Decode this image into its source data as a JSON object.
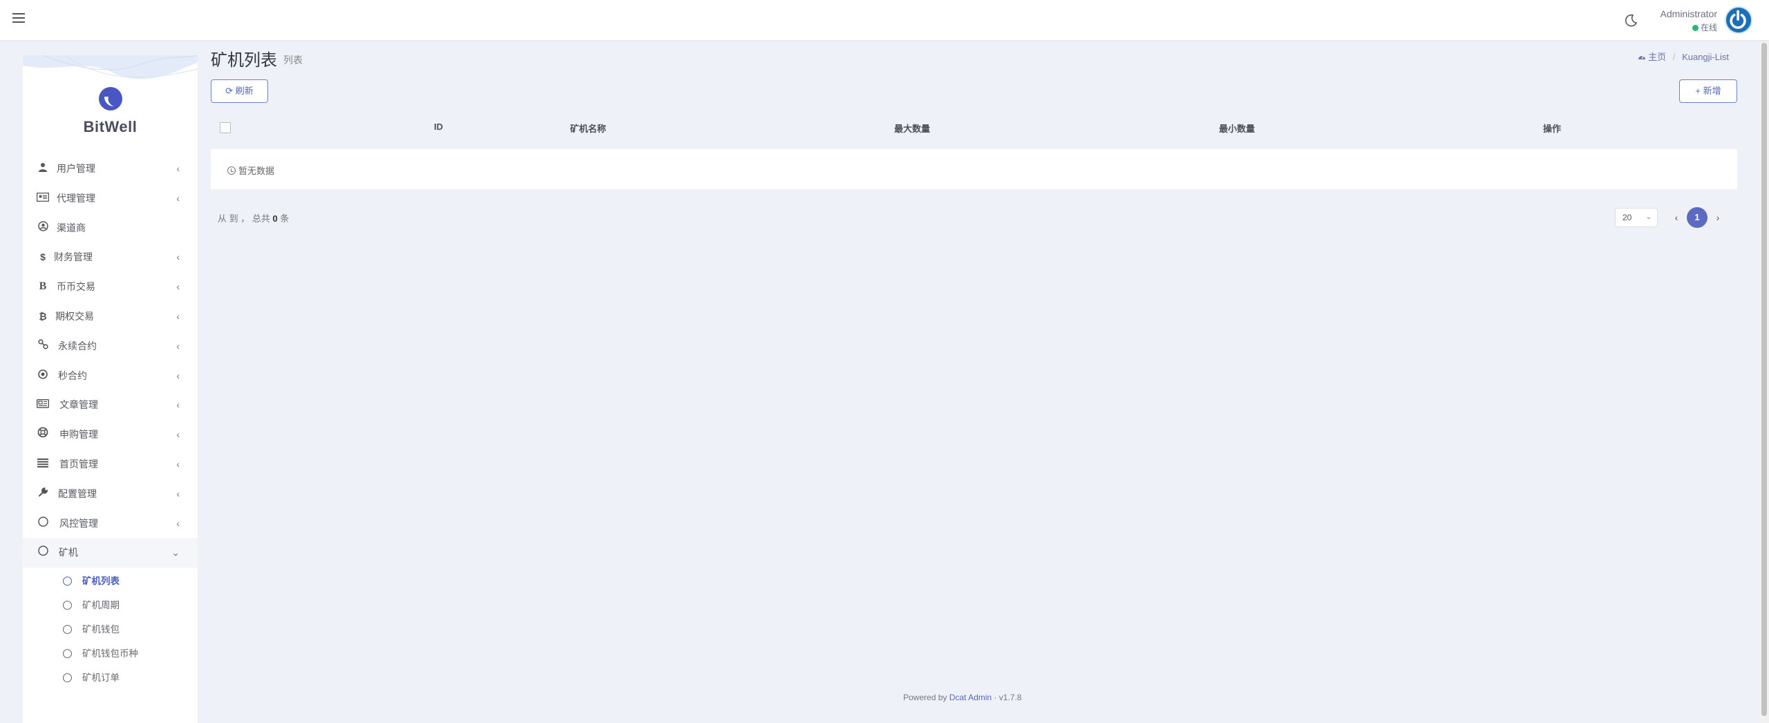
{
  "header": {
    "user_name": "Administrator",
    "user_status": "在线",
    "colors": {
      "status_online": "#21b978",
      "avatar": "#1a6fb8"
    }
  },
  "sidebar": {
    "brand": "BitWell",
    "items": [
      {
        "label": "用户管理",
        "icon": "user-tie-icon"
      },
      {
        "label": "代理管理",
        "icon": "id-card-icon"
      },
      {
        "label": "渠道商",
        "icon": "user-circle-icon"
      },
      {
        "label": "财务管理",
        "icon": "dollar-icon"
      },
      {
        "label": "币币交易",
        "icon": "bold-b-icon"
      },
      {
        "label": "期权交易",
        "icon": "bitcoin-icon"
      },
      {
        "label": "永续合约",
        "icon": "link-icon"
      },
      {
        "label": "秒合约",
        "icon": "dot-circle-icon"
      },
      {
        "label": "文章管理",
        "icon": "newspaper-icon"
      },
      {
        "label": "申购管理",
        "icon": "life-ring-icon"
      },
      {
        "label": "首页管理",
        "icon": "list-icon"
      },
      {
        "label": "配置管理",
        "icon": "wrench-icon"
      },
      {
        "label": "风控管理",
        "icon": "circle-icon"
      },
      {
        "label": "矿机",
        "icon": "circle-icon"
      }
    ],
    "submenu": [
      {
        "label": "矿机列表",
        "active": true
      },
      {
        "label": "矿机周期"
      },
      {
        "label": "矿机钱包"
      },
      {
        "label": "矿机钱包币种"
      },
      {
        "label": "矿机订单"
      }
    ],
    "colors": {
      "active": "#4b5ec2"
    }
  },
  "content": {
    "title": "矿机列表",
    "subtitle": "列表",
    "breadcrumb": {
      "home": "主页",
      "current": "Kuangji-List"
    },
    "refresh_label": "刷新",
    "add_label": "新增",
    "columns": [
      "ID",
      "矿机名称",
      "最大数量",
      "最小数量",
      "操作"
    ],
    "empty_text": "暂无数据",
    "record_info": {
      "prefix": "从 到 ， 总共",
      "count": "0",
      "suffix": "条"
    },
    "page_size": "20",
    "current_page": "1",
    "colors": {
      "primary": "#5c6bc0"
    }
  },
  "footer": {
    "prefix": "Powered by",
    "link": "Dcat Admin",
    "separator": "·",
    "version": "v1.7.8"
  }
}
